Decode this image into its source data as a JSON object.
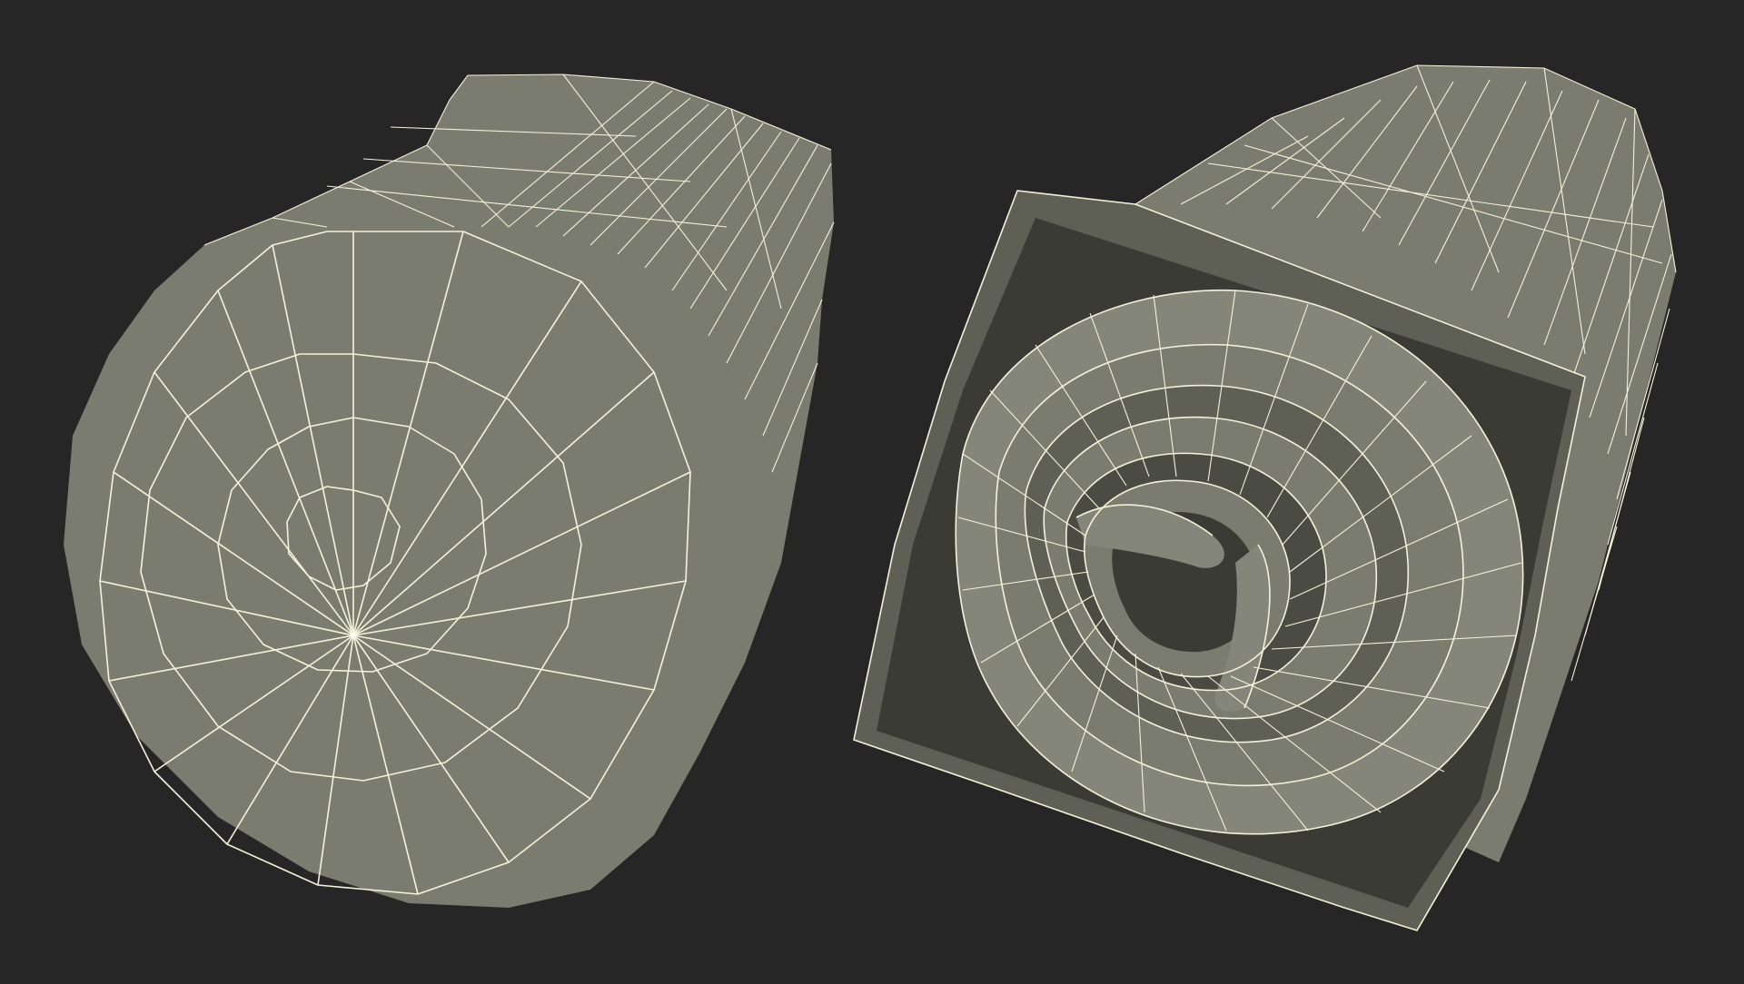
{
  "scene": {
    "background_color": "#262626",
    "surface_color": "#7b7c70",
    "wire_color": "#f4f2d8",
    "objects": [
      {
        "name": "rolled-mat-end-cap-view",
        "icon": "rolled-mat-icon"
      },
      {
        "name": "rolled-mat-spiral-view",
        "icon": "spiral-roll-icon"
      }
    ]
  }
}
